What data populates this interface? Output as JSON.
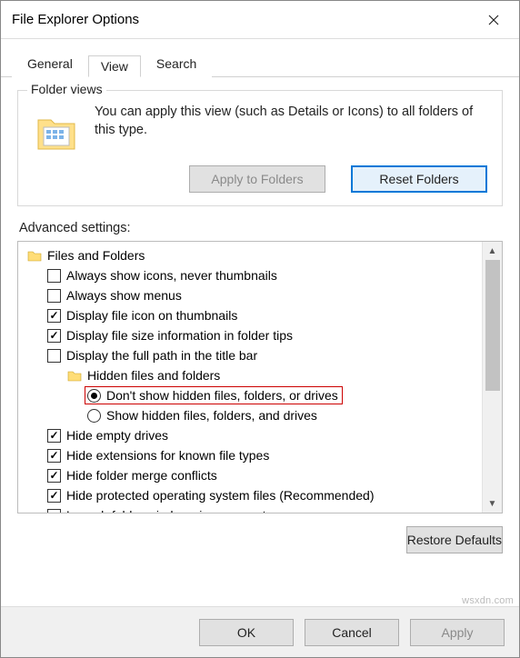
{
  "window": {
    "title": "File Explorer Options"
  },
  "tabs": {
    "general": "General",
    "view": "View",
    "search": "Search",
    "active": "View"
  },
  "folder_views": {
    "legend": "Folder views",
    "text": "You can apply this view (such as Details or Icons) to all folders of this type.",
    "apply_btn": "Apply to Folders",
    "reset_btn": "Reset Folders"
  },
  "advanced": {
    "label": "Advanced settings:",
    "root": "Files and Folders",
    "items": [
      {
        "type": "check",
        "checked": false,
        "label": "Always show icons, never thumbnails"
      },
      {
        "type": "check",
        "checked": false,
        "label": "Always show menus"
      },
      {
        "type": "check",
        "checked": true,
        "label": "Display file icon on thumbnails"
      },
      {
        "type": "check",
        "checked": true,
        "label": "Display file size information in folder tips"
      },
      {
        "type": "check",
        "checked": false,
        "label": "Display the full path in the title bar"
      },
      {
        "type": "folder",
        "label": "Hidden files and folders"
      },
      {
        "type": "radio",
        "selected": true,
        "label": "Don't show hidden files, folders, or drives",
        "highlight": true
      },
      {
        "type": "radio",
        "selected": false,
        "label": "Show hidden files, folders, and drives"
      },
      {
        "type": "check",
        "checked": true,
        "label": "Hide empty drives"
      },
      {
        "type": "check",
        "checked": true,
        "label": "Hide extensions for known file types"
      },
      {
        "type": "check",
        "checked": true,
        "label": "Hide folder merge conflicts"
      },
      {
        "type": "check",
        "checked": true,
        "label": "Hide protected operating system files (Recommended)"
      },
      {
        "type": "check",
        "checked": false,
        "label": "Launch folder windows in a separate process"
      }
    ],
    "restore_btn": "Restore Defaults"
  },
  "footer": {
    "ok": "OK",
    "cancel": "Cancel",
    "apply": "Apply"
  },
  "watermark": "wsxdn.com"
}
